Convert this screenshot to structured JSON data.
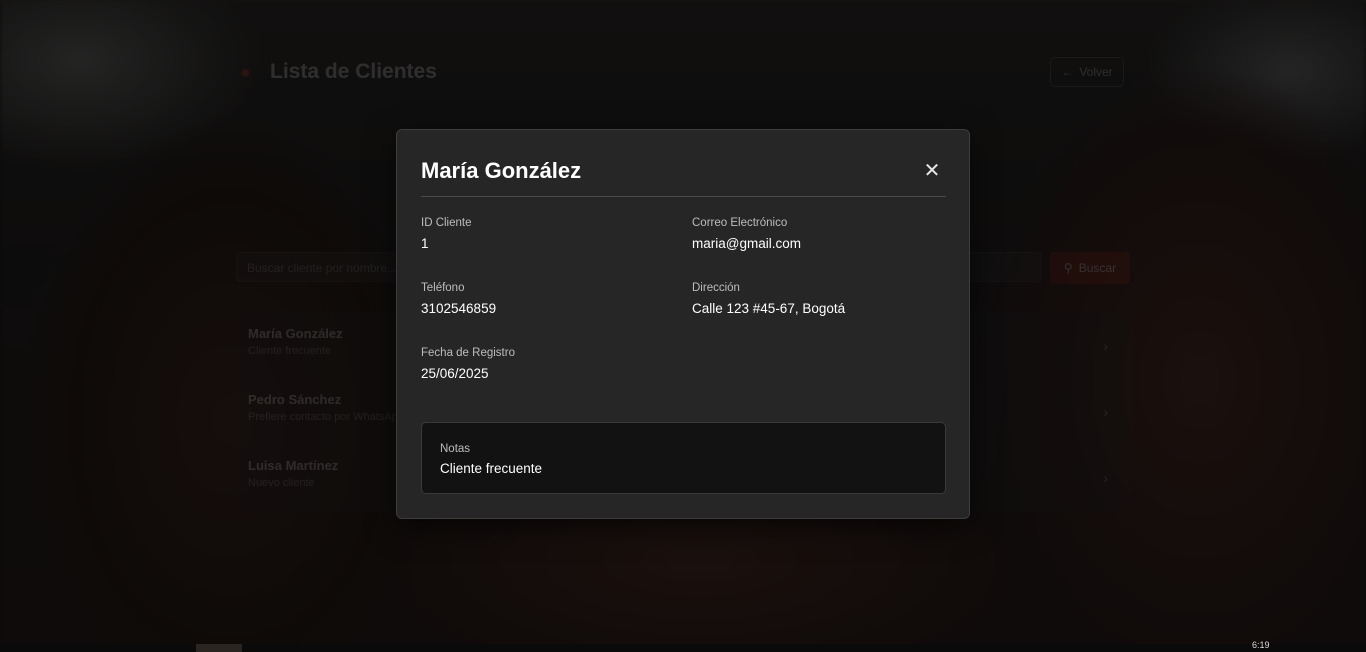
{
  "background_app": {
    "title": "Lista de Clientes",
    "back_button": "Volver",
    "search_placeholder": "Buscar cliente por nombre...",
    "search_button": "Buscar",
    "rows": [
      {
        "name": "María González",
        "subtitle": "Cliente frecuente"
      },
      {
        "name": "Pedro Sánchez",
        "subtitle": "Prefiere contacto por WhatsApp"
      },
      {
        "name": "Luisa Martínez",
        "subtitle": "Nuevo cliente"
      }
    ]
  },
  "modal": {
    "title": "María González",
    "close_icon": "close-icon",
    "fields": {
      "id": {
        "label": "ID Cliente",
        "value": "1"
      },
      "email": {
        "label": "Correo Electrónico",
        "value": "maria@gmail.com"
      },
      "phone": {
        "label": "Teléfono",
        "value": "3102546859"
      },
      "address": {
        "label": "Dirección",
        "value": "Calle 123 #45-67, Bogotá"
      },
      "registered": {
        "label": "Fecha de Registro",
        "value": "25/06/2025"
      }
    },
    "notes": {
      "label": "Notas",
      "value": "Cliente frecuente"
    }
  },
  "taskbar": {
    "clock": "6:19"
  },
  "colors": {
    "accent": "#c0392b",
    "modal_bg": "#262626",
    "notes_bg": "#121212"
  }
}
